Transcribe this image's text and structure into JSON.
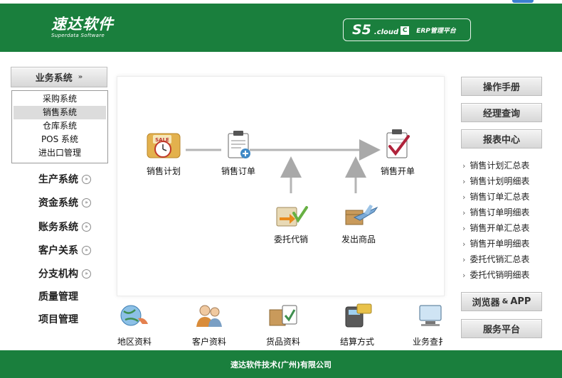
{
  "header": {
    "logo_cn": "速达软件",
    "logo_en": "Superdata Software",
    "product": "S5",
    "product_cloud": ".cloud",
    "product_c": "C",
    "product_subtitle": "ERP管理平台"
  },
  "sidebar": {
    "business_system": "业务系统",
    "sub_items": [
      {
        "label": "采购系统"
      },
      {
        "label": "销售系统",
        "active": true
      },
      {
        "label": "仓库系统"
      },
      {
        "label": "POS 系统"
      },
      {
        "label": "进出口管理"
      }
    ],
    "items": [
      {
        "label": "生产系统",
        "expandable": true
      },
      {
        "label": "资金系统",
        "expandable": true
      },
      {
        "label": "账务系统",
        "expandable": true
      },
      {
        "label": "客户关系",
        "expandable": true
      },
      {
        "label": "分支机构",
        "expandable": true
      },
      {
        "label": "质量管理",
        "expandable": false
      },
      {
        "label": "项目管理",
        "expandable": false
      }
    ]
  },
  "flow": {
    "sales_plan": "销售计划",
    "sales_order": "销售订单",
    "sales_invoice": "销售开单",
    "consignment": "委托代销",
    "ship_goods": "发出商品",
    "sale_tag": "SALE"
  },
  "right": {
    "manual": "操作手册",
    "manager_query": "经理查询",
    "report_center": "报表中心",
    "reports": [
      "销售计划汇总表",
      "销售计划明细表",
      "销售订单汇总表",
      "销售订单明细表",
      "销售开单汇总表",
      "销售开单明细表",
      "委托代销汇总表",
      "委托代销明细表"
    ],
    "browser_app": "浏览器",
    "browser_amp": "&",
    "browser_app2": "APP",
    "service_platform": "服务平台"
  },
  "bottom": {
    "items": [
      "地区资料",
      "客户资料",
      "货品资料",
      "结算方式",
      "业务查扌"
    ]
  },
  "footer": {
    "company": "速达软件技术(广州)有限公司"
  },
  "colors": {
    "brand_green": "#1a7f3d",
    "button_gray": "#d7d7d7"
  }
}
